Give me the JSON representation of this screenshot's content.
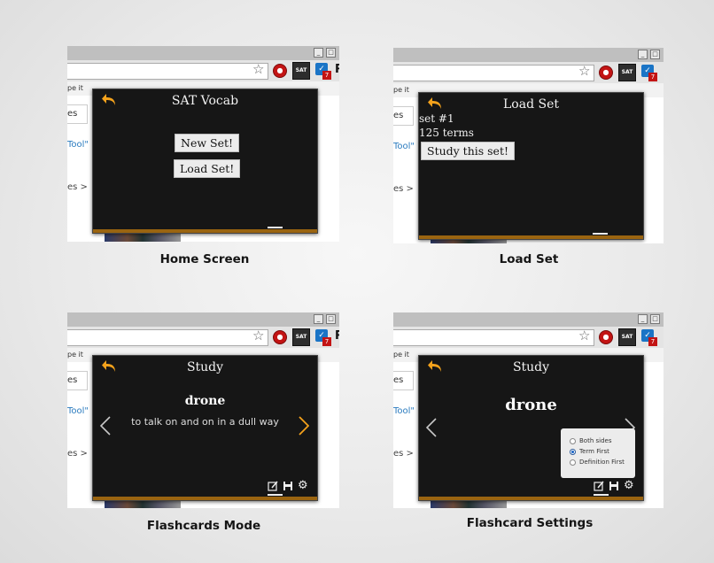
{
  "panels": {
    "home": {
      "title": "SAT Vocab",
      "new_set": "New Set!",
      "load_set": "Load Set!",
      "caption": "Home Screen"
    },
    "load": {
      "title": "Load Set",
      "set_name": "set #1",
      "term_count": "125 terms",
      "study_btn": "Study this set!",
      "caption": "Load Set"
    },
    "flash": {
      "title": "Study",
      "word": "drone",
      "definition": "to talk on and on in a dull way",
      "caption": "Flashcards Mode"
    },
    "settings": {
      "title": "Study",
      "word": "drone",
      "options": [
        "Both sides",
        "Term First",
        "Definition First"
      ],
      "selected": "Term First",
      "caption": "Flashcard Settings"
    }
  },
  "browser": {
    "bookmark_text": "pe it",
    "side_tab": "es",
    "side_link": "Tool\"",
    "side_item": "es  >",
    "extension_label": "SAT",
    "badge_count": "7",
    "r_letter": "R"
  },
  "colors": {
    "popup_bg": "#161616",
    "accent": "#f4a21c",
    "stripe": "#9a6410"
  }
}
